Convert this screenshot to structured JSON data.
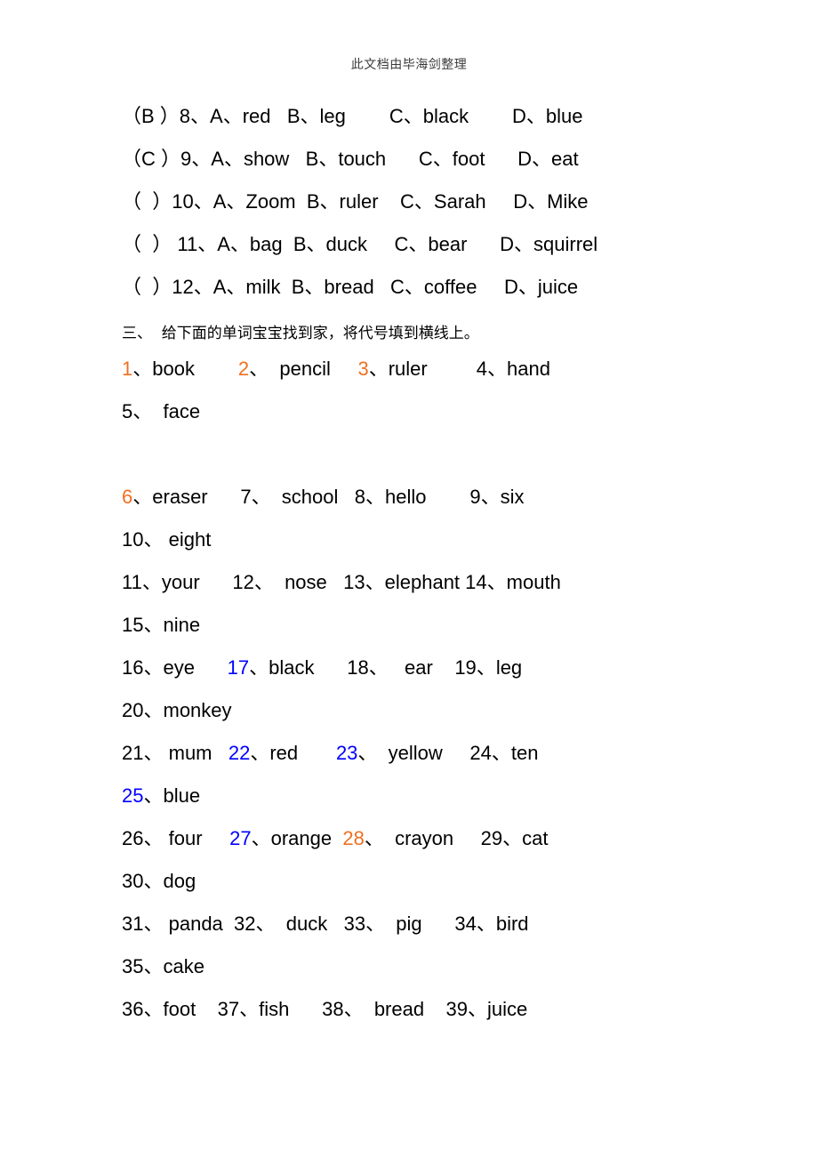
{
  "header": {
    "running_head": "此文档由毕海剑整理"
  },
  "colors": {
    "orange": "#F07020",
    "blue": "#0000FF",
    "black": "#000000",
    "header_gray": "#3A3A3A"
  },
  "multiple_choice": {
    "items": [
      {
        "answer": "（B ）",
        "number": "8、",
        "options": [
          "A、red",
          "B、leg",
          "C、black",
          "D、blue"
        ],
        "gaps": [
          "   ",
          "        ",
          "        ",
          "        "
        ]
      },
      {
        "answer": "（C ）",
        "number": "9、",
        "options": [
          "A、show",
          "B、touch",
          "C、foot",
          "D、eat"
        ],
        "gaps": [
          "   ",
          "      ",
          "      ",
          "       "
        ]
      },
      {
        "answer": "（  ）",
        "number": "10、",
        "options": [
          "A、Zoom",
          "B、ruler",
          "C、Sarah",
          "D、Mike"
        ],
        "gaps": [
          "  ",
          "    ",
          "     ",
          "    "
        ]
      },
      {
        "answer": "（  ）",
        "number": " 11、",
        "options": [
          "A、bag",
          "B、duck",
          "C、bear",
          "D、squirrel"
        ],
        "gaps": [
          "  ",
          "     ",
          "      ",
          "   "
        ]
      },
      {
        "answer": "（  ）",
        "number": "12、",
        "options": [
          "A、milk",
          "B、bread",
          "C、coffee",
          "D、juice"
        ],
        "gaps": [
          "  ",
          "   ",
          "     ",
          "       "
        ]
      }
    ]
  },
  "section_three": {
    "heading": "三、  给下面的单词宝宝找到家，将代号填到横线上。",
    "rows": [
      {
        "spacer_after": false,
        "items": [
          {
            "num": "1",
            "sep": "、",
            "word": "book",
            "color": "orange",
            "gap": "        "
          },
          {
            "num": "2",
            "sep": "、",
            "word": "  pencil",
            "color": "orange",
            "gap": "     "
          },
          {
            "num": "3",
            "sep": "、",
            "word": "ruler",
            "color": "orange",
            "gap": "         "
          },
          {
            "num": "4",
            "sep": "、",
            "word": "hand",
            "color": "black",
            "gap": ""
          }
        ]
      },
      {
        "spacer_after": true,
        "items": [
          {
            "num": "5",
            "sep": "、",
            "word": "  face",
            "color": "black",
            "gap": ""
          }
        ]
      },
      {
        "spacer_after": false,
        "items": [
          {
            "num": "6",
            "sep": "、",
            "word": "eraser",
            "color": "orange",
            "gap": "      "
          },
          {
            "num": "7",
            "sep": "、",
            "word": "  school",
            "color": "black",
            "gap": "   "
          },
          {
            "num": "8",
            "sep": "、",
            "word": "hello",
            "color": "black",
            "gap": "        "
          },
          {
            "num": "9",
            "sep": "、",
            "word": "six",
            "color": "black",
            "gap": ""
          }
        ]
      },
      {
        "spacer_after": false,
        "items": [
          {
            "num": "10",
            "sep": "、",
            "word": " eight",
            "color": "black",
            "gap": ""
          }
        ]
      },
      {
        "spacer_after": false,
        "items": [
          {
            "num": "11",
            "sep": "、",
            "word": "your",
            "color": "black",
            "gap": "      "
          },
          {
            "num": "12",
            "sep": "、",
            "word": "  nose",
            "color": "black",
            "gap": "   "
          },
          {
            "num": "13",
            "sep": "、",
            "word": "elephant",
            "color": "black",
            "gap": " "
          },
          {
            "num": "14",
            "sep": "、",
            "word": "mouth",
            "color": "black",
            "gap": ""
          }
        ]
      },
      {
        "spacer_after": false,
        "items": [
          {
            "num": "15",
            "sep": "、",
            "word": "nine",
            "color": "black",
            "gap": ""
          }
        ]
      },
      {
        "spacer_after": false,
        "items": [
          {
            "num": "16",
            "sep": "、",
            "word": "eye",
            "color": "black",
            "gap": "      "
          },
          {
            "num": "17",
            "sep": "、",
            "word": "black",
            "color": "blue",
            "gap": "      "
          },
          {
            "num": "18",
            "sep": "、",
            "word": "   ear",
            "color": "black",
            "gap": "    "
          },
          {
            "num": "19",
            "sep": "、",
            "word": "leg",
            "color": "black",
            "gap": ""
          }
        ]
      },
      {
        "spacer_after": false,
        "items": [
          {
            "num": "20",
            "sep": "、",
            "word": "monkey",
            "color": "black",
            "gap": ""
          }
        ]
      },
      {
        "spacer_after": false,
        "items": [
          {
            "num": "21",
            "sep": "、",
            "word": " mum",
            "color": "black",
            "gap": "   "
          },
          {
            "num": "22",
            "sep": "、",
            "word": "red",
            "color": "blue",
            "gap": "       "
          },
          {
            "num": "23",
            "sep": "、",
            "word": "  yellow",
            "color": "blue",
            "gap": "     "
          },
          {
            "num": "24",
            "sep": "、",
            "word": "ten",
            "color": "black",
            "gap": ""
          }
        ]
      },
      {
        "spacer_after": false,
        "items": [
          {
            "num": "25",
            "sep": "、",
            "word": "blue",
            "color": "blue",
            "gap": ""
          }
        ]
      },
      {
        "spacer_after": false,
        "items": [
          {
            "num": "26",
            "sep": "、",
            "word": " four",
            "color": "black",
            "gap": "     "
          },
          {
            "num": "27",
            "sep": "、",
            "word": "orange",
            "color": "blue",
            "gap": "  "
          },
          {
            "num": "28",
            "sep": "、",
            "word": "  crayon",
            "color": "orange",
            "gap": "     "
          },
          {
            "num": "29",
            "sep": "、",
            "word": "cat",
            "color": "black",
            "gap": ""
          }
        ]
      },
      {
        "spacer_after": false,
        "items": [
          {
            "num": "30",
            "sep": "、",
            "word": "dog",
            "color": "black",
            "gap": ""
          }
        ]
      },
      {
        "spacer_after": false,
        "items": [
          {
            "num": "31",
            "sep": "、",
            "word": " panda",
            "color": "black",
            "gap": "  "
          },
          {
            "num": "32",
            "sep": "、",
            "word": "  duck",
            "color": "black",
            "gap": "   "
          },
          {
            "num": "33",
            "sep": "、",
            "word": "  pig",
            "color": "black",
            "gap": "      "
          },
          {
            "num": "34",
            "sep": "、",
            "word": "bird",
            "color": "black",
            "gap": ""
          }
        ]
      },
      {
        "spacer_after": false,
        "items": [
          {
            "num": "35",
            "sep": "、",
            "word": "cake",
            "color": "black",
            "gap": ""
          }
        ]
      },
      {
        "spacer_after": false,
        "items": [
          {
            "num": "36",
            "sep": "、",
            "word": "foot",
            "color": "black",
            "gap": "    "
          },
          {
            "num": "37",
            "sep": "、",
            "word": "fish",
            "color": "black",
            "gap": "      "
          },
          {
            "num": "38",
            "sep": "、",
            "word": "  bread",
            "color": "black",
            "gap": "    "
          },
          {
            "num": "39",
            "sep": "、",
            "word": "juice",
            "color": "black",
            "gap": ""
          }
        ]
      }
    ]
  }
}
